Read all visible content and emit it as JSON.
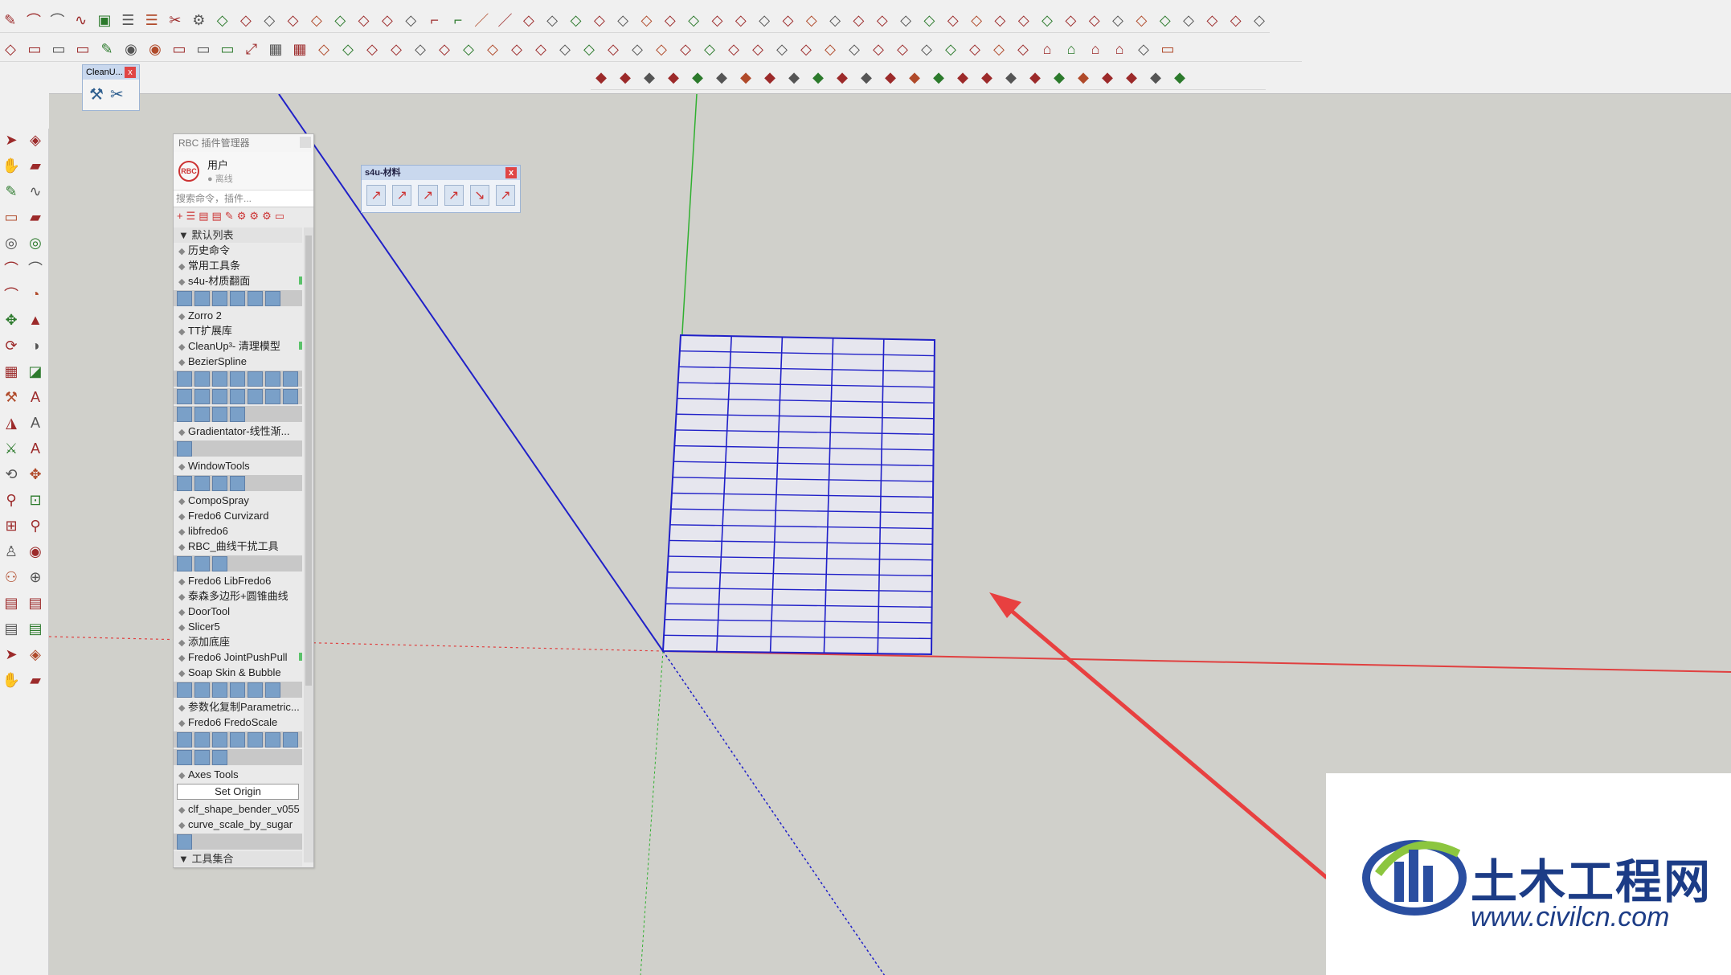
{
  "toolbars": {
    "row1_icons": [
      "draw-icon",
      "arc-icon",
      "curve-icon",
      "spline-icon",
      "box-icon",
      "layers-icon",
      "stack-icon",
      "cut-icon",
      "gear-icon",
      "shape-icon",
      "shape-icon",
      "shape-icon",
      "shape-icon",
      "shape-icon",
      "shape-icon",
      "shape-icon",
      "shape-icon",
      "shape-icon",
      "line-icon",
      "line-icon",
      "line-icon",
      "line-icon",
      "shape-icon",
      "shape-icon",
      "shape-icon",
      "shape-icon",
      "shape-icon",
      "shape-icon",
      "shape-icon",
      "shape-icon",
      "shape-icon",
      "shape-icon",
      "shape-icon",
      "shape-icon",
      "shape-icon",
      "shape-icon",
      "shape-icon",
      "shape-icon",
      "shape-icon",
      "shape-icon",
      "shape-icon",
      "shape-icon",
      "shape-icon",
      "shape-icon",
      "shape-icon",
      "shape-icon",
      "shape-icon",
      "shape-icon",
      "shape-icon",
      "shape-icon",
      "shape-icon",
      "shape-icon",
      "shape-icon",
      "shape-icon"
    ],
    "row2_icons": [
      "shape-icon",
      "folder-icon",
      "text-icon",
      "image-icon",
      "pen-icon",
      "circle-icon",
      "circle-icon",
      "pm-icon",
      "doc-icon",
      "doc-icon",
      "expand-icon",
      "grid-icon",
      "map-icon",
      "tag-icon",
      "tool-icon",
      "tool-icon",
      "tool-icon",
      "tool-icon",
      "tool-icon",
      "tool-icon",
      "tool-icon",
      "tool-icon",
      "tool-icon",
      "tool-icon",
      "tool-icon",
      "tool-icon",
      "tool-icon",
      "tool-icon",
      "tool-icon",
      "tool-icon",
      "tool-icon",
      "tool-icon",
      "tool-icon",
      "tool-icon",
      "tool-icon",
      "tool-icon",
      "tool-icon",
      "tool-icon",
      "tool-icon",
      "tool-icon",
      "tool-icon",
      "tool-icon",
      "tool-icon",
      "tool-icon",
      "tool-icon",
      "house-icon",
      "house-icon",
      "house-icon",
      "house-icon"
    ],
    "row3_icons": [
      "box-icon",
      "box-icon",
      "box-icon",
      "box-icon",
      "box-icon",
      "box-icon",
      "box-icon",
      "box-icon",
      "box-icon",
      "box-icon",
      "box-icon",
      "box-icon",
      "box-icon",
      "box-icon",
      "box-icon",
      "box-icon",
      "box-icon",
      "box-icon",
      "box-icon",
      "box-icon",
      "box-icon",
      "box-icon",
      "box-icon",
      "box-icon",
      "box-icon"
    ],
    "row1_glyphs": "✎⌒⌒∿▣☰☰✂⚙◇◇◇◇◇◇◇◇◇⌐⌐／／◇◇◇◇◇◇◇◇◇◇◇◇◇◇◇◇◇◇◇◇◇◇◇◇◇◇◇◇◇◇◇◇◇",
    "row2_glyphs": "◇▭▭▭✎◉◉▭▭▭⤢▦▦◇◇◇◇◇◇◇◇◇◇◇◇◇◇◇◇◇◇◇◇◇◇◇◇◇◇◇◇◇◇⌂⌂⌂⌂",
    "row3_glyphs": "◆◆◆◆◆◆◆◆◆◆◆◆◆◆◆◆◆◆◆◆◆◆◆◆◆"
  },
  "cleanup_mini": {
    "title": "CleanU...",
    "close": "x"
  },
  "rbc": {
    "title": "RBC 插件管理器",
    "user": "用户",
    "user_status": "● 离线",
    "avatar_text": "RBC",
    "search_placeholder": "搜索命令，插件...",
    "items": [
      {
        "label": "▼ 默认列表",
        "kind": "section"
      },
      {
        "label": "历史命令"
      },
      {
        "label": "常用工具条"
      },
      {
        "label": "s4u-材质翻面",
        "tag": true
      },
      {
        "label": "",
        "strip": 6
      },
      {
        "label": "Zorro 2"
      },
      {
        "label": "TT扩展库"
      },
      {
        "label": "CleanUp³- 清理模型",
        "tag": true
      },
      {
        "label": "BezierSpline"
      },
      {
        "label": "",
        "strip": 7
      },
      {
        "label": "",
        "strip": 7
      },
      {
        "label": "",
        "strip": 4
      },
      {
        "label": "Gradientator-线性渐..."
      },
      {
        "label": "",
        "strip": 1
      },
      {
        "label": "WindowTools"
      },
      {
        "label": "",
        "strip": 4
      },
      {
        "label": "CompoSpray"
      },
      {
        "label": "Fredo6 Curvizard"
      },
      {
        "label": "libfredo6"
      },
      {
        "label": "RBC_曲线干扰工具"
      },
      {
        "label": "",
        "strip": 3
      },
      {
        "label": "Fredo6 LibFredo6"
      },
      {
        "label": "泰森多边形+圆锥曲线"
      },
      {
        "label": "DoorTool"
      },
      {
        "label": "Slicer5"
      },
      {
        "label": "添加底座"
      },
      {
        "label": "Fredo6 JointPushPull",
        "tag": true
      },
      {
        "label": "Soap Skin & Bubble"
      },
      {
        "label": "",
        "strip": 6
      },
      {
        "label": "参数化复制Parametric..."
      },
      {
        "label": "Fredo6 FredoScale"
      },
      {
        "label": "",
        "strip": 7
      },
      {
        "label": "",
        "strip": 3
      },
      {
        "label": "Axes Tools"
      },
      {
        "label": "Set Origin",
        "button": true
      },
      {
        "label": "clf_shape_bender_v055"
      },
      {
        "label": "curve_scale_by_sugar"
      },
      {
        "label": "",
        "strip": 1
      },
      {
        "label": "▼ 工具集合",
        "kind": "section"
      }
    ]
  },
  "s4u_panel": {
    "title": "s4u-材料",
    "close": "x",
    "icons": [
      "↗",
      "↗",
      "↗",
      "↗",
      "↘",
      "↗"
    ]
  },
  "watermark": {
    "cn": "土木工程网",
    "url": "www.civilcn.com"
  },
  "colors": {
    "viewport": "#d0d0cb",
    "grid_line": "#2020c8",
    "axis_red": "#e04040",
    "axis_green": "#30b030",
    "axis_blue": "#2020c8",
    "arrow": "#e84040"
  }
}
